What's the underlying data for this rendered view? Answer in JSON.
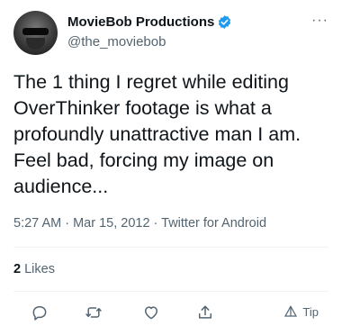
{
  "user": {
    "display_name": "MovieBob Productions",
    "handle": "@the_moviebob",
    "verified": true
  },
  "tweet": {
    "text": "The 1 thing I regret while editing OverThinker footage is what a profoundly unattractive man I am. Feel bad, forcing my image on audience...",
    "meta": "5:27 AM · Mar 15, 2012 · Twitter for Android"
  },
  "engagement": {
    "likes_count": "2",
    "likes_label": "Likes"
  },
  "actions": {
    "more_label": "···",
    "tip_label": "Tip",
    "icons": [
      "reply-icon",
      "retweet-icon",
      "like-icon",
      "share-icon",
      "tip-icon"
    ]
  },
  "colors": {
    "text_primary": "#0f1419",
    "text_secondary": "#536471",
    "verified_blue": "#1d9bf0",
    "divider": "#eff3f4"
  }
}
